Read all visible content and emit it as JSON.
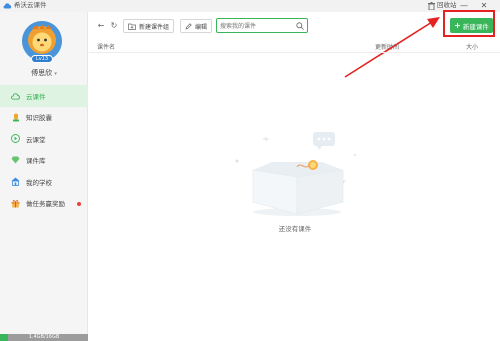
{
  "app": {
    "title": "希沃云课件"
  },
  "titlebar": {
    "recycle_label": "回收站",
    "minimize_glyph": "—",
    "close_glyph": "✕"
  },
  "user": {
    "name": "傅思欣",
    "level": "Lv13",
    "dropdown_glyph": "▾"
  },
  "sidebar": {
    "items": [
      {
        "label": "云课件",
        "icon": "cloud-icon",
        "active": true
      },
      {
        "label": "知识胶囊",
        "icon": "capsule-icon",
        "active": false
      },
      {
        "label": "云课堂",
        "icon": "play-circle-icon",
        "active": false
      },
      {
        "label": "课件库",
        "icon": "diamond-icon",
        "active": false
      },
      {
        "label": "我的学校",
        "icon": "school-icon",
        "active": false
      },
      {
        "label": "做任务赢奖励",
        "icon": "gift-icon",
        "active": false,
        "badge_dot": true
      }
    ],
    "storage": {
      "text": "1.4GB/16GB",
      "used_fraction": 0.0875
    }
  },
  "toolbar": {
    "back_glyph": "←",
    "refresh_glyph": "↻",
    "new_group_label": "新建课件组",
    "edit_label": "编辑",
    "new_courseware_label": "新建课件",
    "new_courseware_glyph": "+"
  },
  "search": {
    "placeholder": "搜索我的课件"
  },
  "table": {
    "col_name": "课件名",
    "col_time": "更新时间",
    "col_size": "大小"
  },
  "empty_state": {
    "message": "还没有课件"
  },
  "colors": {
    "accent": "#3ab65a",
    "highlight": "#e52222",
    "active_bg": "#dff3e3"
  }
}
